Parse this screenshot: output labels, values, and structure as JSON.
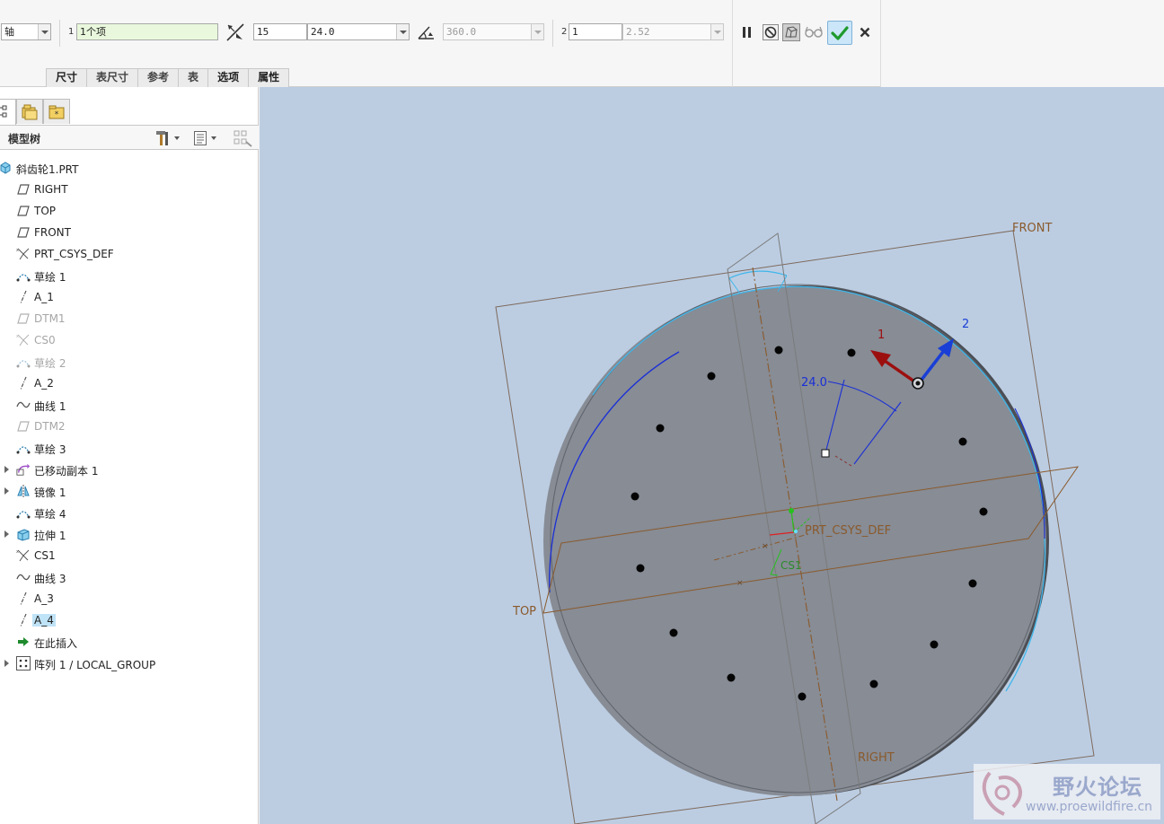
{
  "dashboard": {
    "type_select": "轴",
    "ref1_label": "1",
    "ref1_value": "1个项",
    "member_count": "15",
    "angle_value": "24.0",
    "angle_extent": "360.0",
    "dir2_label": "2",
    "dir2_count": "1",
    "dir2_value": "2.52",
    "tabs": [
      "尺寸",
      "表尺寸",
      "参考",
      "表",
      "选项",
      "属性"
    ]
  },
  "tree": {
    "header": "模型树",
    "items": [
      {
        "label": "斜齿轮1.PRT",
        "icon": "part-icon",
        "depth": 0,
        "dim": false,
        "expandable": false
      },
      {
        "label": "RIGHT",
        "icon": "datum-plane-icon",
        "depth": 1,
        "dim": false,
        "expandable": false
      },
      {
        "label": "TOP",
        "icon": "datum-plane-icon",
        "depth": 1,
        "dim": false,
        "expandable": false
      },
      {
        "label": "FRONT",
        "icon": "datum-plane-icon",
        "depth": 1,
        "dim": false,
        "expandable": false
      },
      {
        "label": "PRT_CSYS_DEF",
        "icon": "csys-icon",
        "depth": 1,
        "dim": false,
        "expandable": false
      },
      {
        "label": "草绘 1",
        "icon": "sketch-icon",
        "depth": 1,
        "dim": false,
        "expandable": false
      },
      {
        "label": "A_1",
        "icon": "axis-icon",
        "depth": 1,
        "dim": false,
        "expandable": false
      },
      {
        "label": "DTM1",
        "icon": "datum-plane-icon",
        "depth": 1,
        "dim": true,
        "expandable": false
      },
      {
        "label": "CS0",
        "icon": "csys-icon",
        "depth": 1,
        "dim": true,
        "expandable": false
      },
      {
        "label": "草绘 2",
        "icon": "sketch-icon",
        "depth": 1,
        "dim": true,
        "expandable": false
      },
      {
        "label": "A_2",
        "icon": "axis-icon",
        "depth": 1,
        "dim": false,
        "expandable": false
      },
      {
        "label": "曲线 1",
        "icon": "curve-icon",
        "depth": 1,
        "dim": false,
        "expandable": false
      },
      {
        "label": "DTM2",
        "icon": "datum-plane-icon",
        "depth": 1,
        "dim": true,
        "expandable": false
      },
      {
        "label": "草绘 3",
        "icon": "sketch-icon",
        "depth": 1,
        "dim": false,
        "expandable": false
      },
      {
        "label": "已移动副本 1",
        "icon": "moved-copy-icon",
        "depth": 1,
        "dim": false,
        "expandable": true
      },
      {
        "label": "镜像 1",
        "icon": "mirror-icon",
        "depth": 1,
        "dim": false,
        "expandable": true
      },
      {
        "label": "草绘 4",
        "icon": "sketch-icon",
        "depth": 1,
        "dim": false,
        "expandable": false
      },
      {
        "label": "拉伸 1",
        "icon": "extrude-icon",
        "depth": 1,
        "dim": false,
        "expandable": true
      },
      {
        "label": "CS1",
        "icon": "csys-icon",
        "depth": 1,
        "dim": false,
        "expandable": false
      },
      {
        "label": "曲线 3",
        "icon": "curve-icon",
        "depth": 1,
        "dim": false,
        "expandable": false
      },
      {
        "label": "A_3",
        "icon": "axis-icon",
        "depth": 1,
        "dim": false,
        "expandable": false
      },
      {
        "label": "A_4",
        "icon": "axis-icon",
        "depth": 1,
        "dim": false,
        "expandable": false,
        "selected": true
      },
      {
        "label": "在此插入",
        "icon": "insert-here-icon",
        "depth": 1,
        "dim": false,
        "expandable": false
      },
      {
        "label": "阵列 1 / LOCAL_GROUP",
        "icon": "pattern-icon",
        "depth": 1,
        "dim": false,
        "expandable": true
      }
    ]
  },
  "viewport": {
    "labels": {
      "front": "FRONT",
      "top": "TOP",
      "right": "RIGHT",
      "csys_def": "PRT_CSYS_DEF",
      "cs1": "CS1",
      "dir1": "1",
      "dir2": "2",
      "angle_dim": "24.0"
    },
    "colors": {
      "background": "#bccde2",
      "part_face": "#878c95",
      "part_rim": "#4b4e54",
      "datum_plane": "#8a5a2c",
      "direction1": "#9c0f0f",
      "direction2": "#1a3fd6"
    }
  },
  "watermark": {
    "title": "野火论坛",
    "url": "www.proewildfire.cn"
  }
}
